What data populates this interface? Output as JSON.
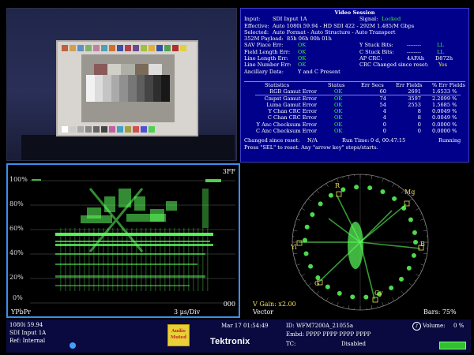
{
  "session": {
    "title": "Video Session",
    "input_label": "Input:",
    "input_value": "SDI Input 1A",
    "signal_label": "Signal:",
    "signal_value": "Locked",
    "effective_label": "Effective:",
    "effective_value": "Auto 1080i 59.94 - HD SDI 422 - 292M 1.485/M Gbps",
    "selected_label": "Selected:",
    "selected_value": "Auto Format - Auto Structure - Auto Transport",
    "payload_label": "352M Payload:",
    "payload_value": "85h 06h 00h 01h",
    "sav_label": "SAV Place Err:",
    "sav_value": "OK",
    "fieldlen_label": "Field Length Err:",
    "fieldlen_value": "OK",
    "lineerr_label": "Line Length Err:",
    "lineerr_value": "OK",
    "linenum_label": "Line Number Err:",
    "linenum_value": "OK",
    "ancillary_label": "Ancillary Data:",
    "ancillary_value": "Y and C Present",
    "ystuck_label": "Y Stuck Bits:",
    "ystuck_value": "LL",
    "cstuck_label": "C Stuck Bits:",
    "cstuck_value": "LL",
    "apcrc_label": "AP CRC:",
    "apcrc_value1": "4AFAh",
    "apcrc_value2": "D872h",
    "crcchanged_label": "CRC Changed since reset:",
    "crcchanged_value": "Yes",
    "stuck_dashes": "--------",
    "table": {
      "headers": [
        "Statistics",
        "Status",
        "Err Secs",
        "Err Fields",
        "% Err Fields"
      ],
      "rows": [
        [
          "RGB Gamut Error",
          "OK",
          "60",
          "2691",
          "1.6533 %"
        ],
        [
          "Cmpst Gamut Error",
          "OK",
          "74",
          "3597",
          "2.2099 %"
        ],
        [
          "Luma Gamut Error",
          "OK",
          "54",
          "2553",
          "1.5685 %"
        ],
        [
          "Y Chan CRC Error",
          "OK",
          "4",
          "8",
          "0.0049 %"
        ],
        [
          "C Chan CRC Error",
          "OK",
          "4",
          "8",
          "0.0049 %"
        ],
        [
          "Y Anc Checksum Error",
          "OK",
          "0",
          "0",
          "0.0000 %"
        ],
        [
          "C Anc Checksum Error",
          "OK",
          "0",
          "0",
          "0.0000 %"
        ]
      ]
    },
    "changed_label": "Changed since reset:",
    "changed_value": "N/A",
    "runtime_label": "Run Time:",
    "runtime_value": "0 d, 00:47:15",
    "running": "Running",
    "help": "Press \"SEL\" to reset.   Any \"arrow key\" stops/starts."
  },
  "waveform": {
    "ticks": [
      "100%",
      "80%",
      "60%",
      "40%",
      "20%",
      "0%"
    ],
    "top_right": "3FF",
    "bottom_right": "000",
    "mode": "YPbPr",
    "scale": "3 μs/Div"
  },
  "vector": {
    "targets": [
      "R",
      "Mg",
      "B",
      "Cy",
      "G",
      "Yl"
    ],
    "gain": "V Gain: x2.00",
    "mode": "Vector",
    "bars": "Bars: 75%"
  },
  "status": {
    "format": "1080i 59.94",
    "input": "SDI Input 1A",
    "ref": "Ref: Internal",
    "audio_badge_line1": "Audio",
    "audio_badge_line2": "Muted",
    "date": "Mar 17  01:54:49",
    "brand": "Tektronix",
    "id": "ID: WFM7200A_21055a",
    "embd": "Embd: PPPP PPPP PPPP PPPP",
    "tc_label": "TC:",
    "tc_value": "Disabled",
    "volume_label": "Volume:",
    "volume_value": "0 %"
  },
  "colors": {
    "session_bg": "#00008a",
    "ok": "#3cf03c",
    "trace": "#5cff5c",
    "waveform_border": "#3a8ff0"
  }
}
